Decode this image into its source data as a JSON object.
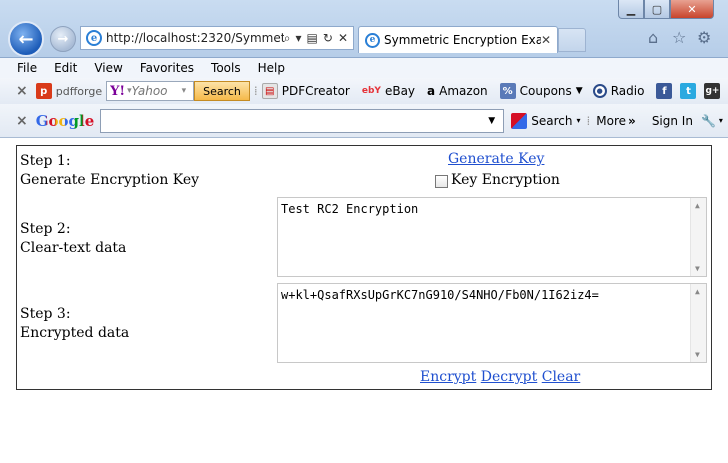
{
  "browser": {
    "address": "http://localhost:2320/Symmetr",
    "tab_title": "Symmetric Encryption Exa...",
    "menu": [
      "File",
      "Edit",
      "View",
      "Favorites",
      "Tools",
      "Help"
    ]
  },
  "toolbar": {
    "pdfforge": "pdfforge",
    "yahoo_logo": "Y!",
    "yahoo_placeholder": "Yahoo",
    "search_btn": "Search",
    "pdfcreator": "PDFCreator",
    "ebay_logo": "ebY",
    "ebay": "eBay",
    "amazon": "Amazon",
    "coupons": "Coupons",
    "radio": "Radio"
  },
  "google_bar": {
    "logo": "Google",
    "search": "Search",
    "more": "More",
    "signin": "Sign In"
  },
  "page": {
    "step1": "Step 1:",
    "step1_desc": "Generate Encryption Key",
    "generate_key": "Generate Key",
    "key_encryption": "Key Encryption",
    "step2": "Step 2:",
    "step2_desc": "Clear-text data",
    "clear_text": "Test RC2 Encryption",
    "step3": "Step 3:",
    "step3_desc": "Encrypted data",
    "encrypted_text": "w+kl+QsafRXsUpGrKC7nG910/S4NHO/Fb0N/1I62iz4=",
    "encrypt": "Encrypt",
    "decrypt": "Decrypt",
    "clear": "Clear"
  }
}
